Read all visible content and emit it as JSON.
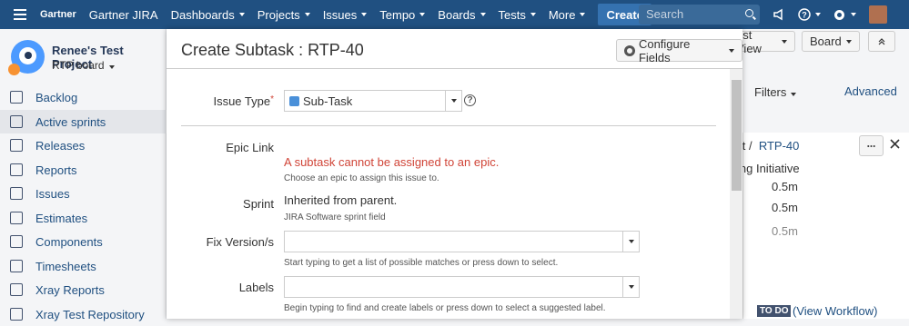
{
  "topnav": {
    "brand": "Gartner",
    "app_title": "Gartner JIRA",
    "items": [
      "Dashboards",
      "Projects",
      "Issues",
      "Tempo",
      "Boards",
      "Tests",
      "More"
    ],
    "create_label": "Create",
    "search_placeholder": "Search"
  },
  "sidebar": {
    "project_name": "Renee's Test Project",
    "board_name": "RTP board",
    "items": [
      "Backlog",
      "Active sprints",
      "Releases",
      "Reports",
      "Issues",
      "Estimates",
      "Components",
      "Timesheets",
      "Xray Reports",
      "Xray Test Repository"
    ],
    "active_item": "Active sprints"
  },
  "background": {
    "view_button": "est View",
    "board_button": "Board",
    "filters_label": "Filters",
    "advanced_link": "Advanced",
    "breadcrumb_prefix": "ect /",
    "issue_key": "RTP-40",
    "initiative_label": "ing Initiative",
    "times": [
      "0.5m",
      "0.5m",
      "0.5m"
    ],
    "status_badge": "TO DO",
    "view_workflow": "(View Workflow)"
  },
  "dialog": {
    "title": "Create Subtask : RTP-40",
    "configure_fields": "Configure Fields",
    "issue_type": {
      "label": "Issue Type",
      "required_marker": "*",
      "value": "Sub-Task"
    },
    "epic_link": {
      "label": "Epic Link",
      "error": "A subtask cannot be assigned to an epic.",
      "hint": "Choose an epic to assign this issue to."
    },
    "sprint": {
      "label": "Sprint",
      "value": "Inherited from parent.",
      "hint": "JIRA Software sprint field"
    },
    "fix_versions": {
      "label": "Fix Version/s",
      "value": "",
      "hint": "Start typing to get a list of possible matches or press down to select."
    },
    "labels": {
      "label": "Labels",
      "value": "",
      "hint": "Begin typing to find and create labels or press down to select a suggested label."
    }
  },
  "colors": {
    "nav": "#205081",
    "link": "#205081",
    "error": "#d04437"
  }
}
